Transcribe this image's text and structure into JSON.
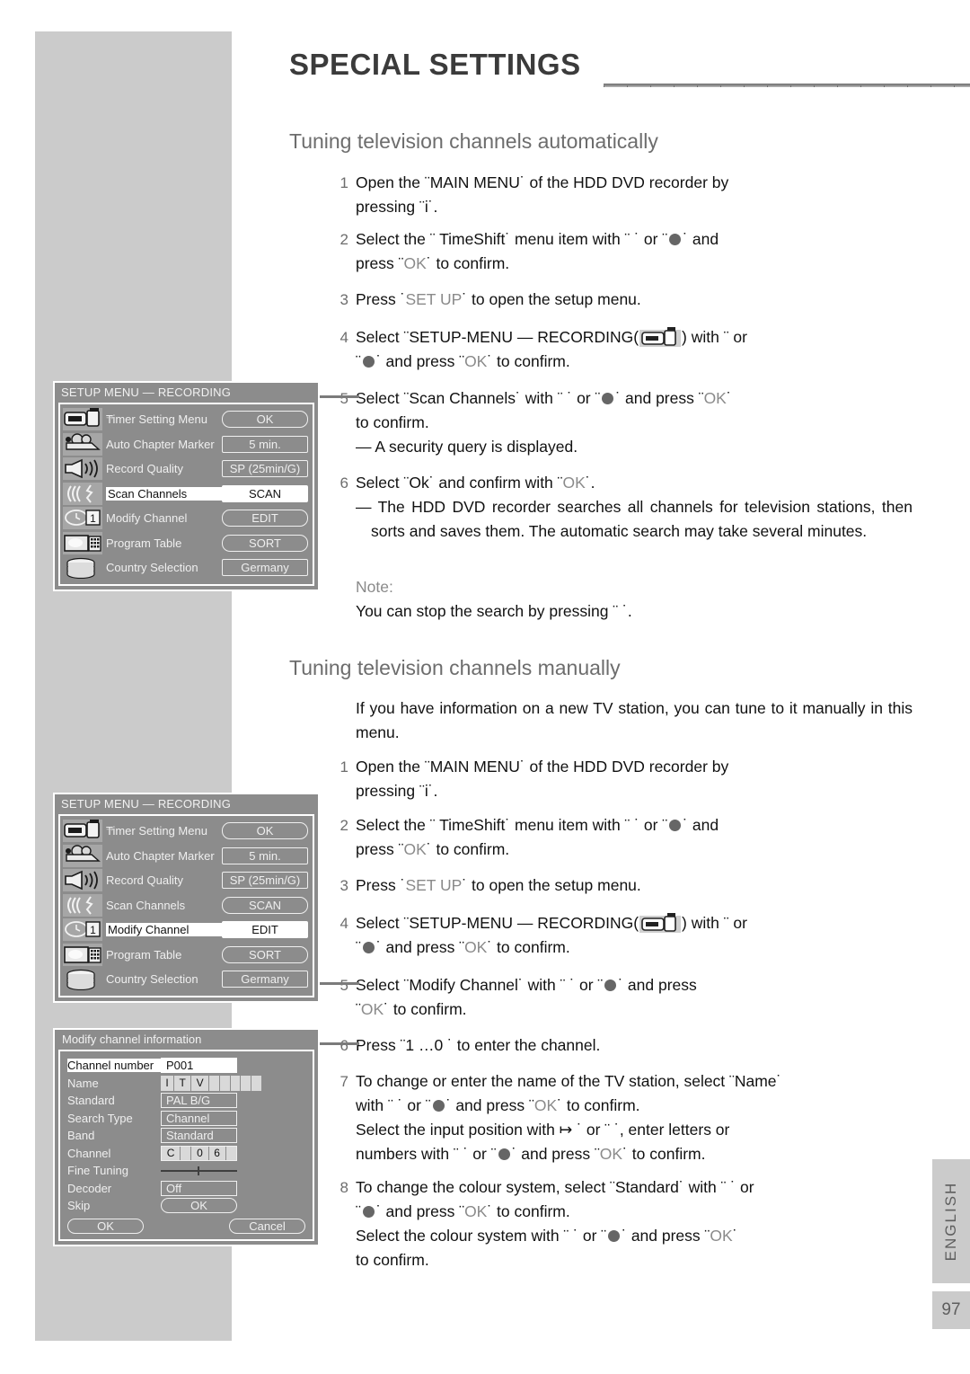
{
  "header": {
    "title": "SPECIAL SETTINGS"
  },
  "sections": {
    "auto": {
      "heading": "Tuning television channels automatically",
      "steps": [
        {
          "num": "1",
          "text_parts": [
            "Open the ¨MAIN MENU˙ of the HDD DVD recorder by pressing ¨i˙."
          ]
        },
        {
          "num": "2",
          "text_parts": [
            "Select the ¨      TimeShift˙ menu item with ¨   ˙ or ¨",
            "˙ and press ¨OK˙ to confirm."
          ]
        },
        {
          "num": "3",
          "text_parts": [
            "Press ˙SET UP˙ to open the setup menu."
          ]
        },
        {
          "num": "4",
          "text_parts": [
            "Select ¨SETUP-MENU — RECORDING(",
            ") with ¨ or ¨",
            "˙ and press ¨OK˙ to confirm."
          ]
        },
        {
          "num": "5",
          "text_parts": [
            "Select ¨Scan Channels˙ with ¨   ˙ or ¨",
            "˙ and press ¨OK˙ to confirm."
          ],
          "dash": "— A security query is displayed."
        },
        {
          "num": "6",
          "text_parts": [
            "Select ¨Ok˙ and confirm with ¨OK˙."
          ],
          "dash": "— The HDD DVD recorder searches all channels for television stations, then sorts and saves them. The automatic search may take several minutes."
        }
      ],
      "note_label": "Note:",
      "note_text": "You can stop the search by pressing ¨  ˙."
    },
    "manual": {
      "heading": "Tuning television channels manually",
      "intro": "If you have information on a new TV station, you can tune to it manually in this menu.",
      "steps": [
        {
          "num": "1",
          "text": "Open the ¨MAIN MENU˙ of the HDD DVD recorder by pressing ¨i˙."
        },
        {
          "num": "2",
          "text": "Select the ¨      TimeShift˙ menu item with ¨   ˙ or ¨"
        },
        {
          "num": "3",
          "text": "Press ˙SET UP˙ to open the setup menu."
        },
        {
          "num": "4",
          "text": "Select ¨SETUP-MENU — RECORDING("
        },
        {
          "num": "5",
          "text": "Select ¨Modify Channel˙ with ¨   ˙ or ¨"
        },
        {
          "num": "6",
          "text": "Press ¨1 …0 ˙ to enter the channel."
        },
        {
          "num": "7",
          "text": "To change or enter the name of the TV station, select ¨Name˙"
        },
        {
          "num": "8",
          "text": "To change the colour system, select ¨Standard˙ with ¨ ˙ or"
        }
      ]
    }
  },
  "fragments": {
    "ok": "OK",
    "setup": "SET UP",
    "and_press_ok_confirm": "˙ and press ¨OK˙ to confirm.",
    "press_ok_confirm": "press ¨OK˙ to confirm.",
    "s2_a": "Select the ¨      TimeShift˙ menu item with ¨   ˙ or ¨",
    "s2_b": "˙ and",
    "s2_c": "press ¨",
    "s2_d": "˙ to confirm.",
    "s3_a": "Press ˙",
    "s3_b": "˙ to open the setup menu.",
    "s4_a": "Select ¨SETUP-MENU — RECORDING(",
    "s4_b": ") with ¨ or",
    "s4_c": "¨",
    "s4_d": "˙ and press ¨",
    "s4_e": "˙ to confirm.",
    "s5auto_a": "Select ¨Scan Channels˙ with ¨   ˙ or ¨",
    "s5auto_b": "˙ and press ¨",
    "s5auto_c": "˙",
    "s5auto_d": "to confirm.",
    "s5auto_dash": "— A security query is displayed.",
    "s6auto_a": "Select ¨Ok˙ and confirm with ¨",
    "s6auto_b": "˙.",
    "s6auto_dash": "— The HDD DVD recorder searches all channels for television stations, then sorts and saves them. The automatic search may take several minutes.",
    "s1_a": "Open the ¨MAIN MENU˙ of the HDD DVD recorder by",
    "s1_b": "pressing ¨i˙.",
    "m5_a": "Select ¨Modify Channel˙ with ¨   ˙ or ¨",
    "m5_b": "˙ and press",
    "m5_c": "¨",
    "m5_d": "˙ to confirm.",
    "m6": "Press ¨1 …0 ˙ to enter the channel.",
    "m7_a": "To change or enter the name of the TV station, select ¨Name˙",
    "m7_b": "with ¨   ˙ or ¨",
    "m7_c": "˙ and press ¨",
    "m7_d": "˙ to confirm.",
    "m7_e": "Select the input position with ↦ ˙ or ¨     ˙, enter letters or",
    "m7_f": "numbers with ¨   ˙ or ¨",
    "m7_g": "˙ and press ¨",
    "m7_h": "˙ to confirm.",
    "m8_a": "To change the colour system, select ¨Standard˙ with ¨ ˙ or",
    "m8_b": "¨",
    "m8_c": "˙ and press ¨",
    "m8_d": "˙ to confirm.",
    "m8_e": "Select the colour system with ¨ ˙ or ¨",
    "m8_f": "˙ and press ¨",
    "m8_g": "˙",
    "m8_h": "to confirm."
  },
  "osd_menu": {
    "title": "SETUP MENU — RECORDING",
    "arrow": "→",
    "rows": [
      {
        "icon": "camcorder-icon",
        "label": "Timer Setting Menu",
        "value": "OK",
        "shape": "round"
      },
      {
        "icon": "projector-icon",
        "label": "Auto Chapter Marker",
        "value": "5 min.",
        "shape": "square"
      },
      {
        "icon": "speaker-icon",
        "label": "Record Quality",
        "value": "SP (25min/G)",
        "shape": "square"
      },
      {
        "icon": "signal-icon",
        "label": "Scan Channels",
        "value": "SCAN",
        "shape": "round"
      },
      {
        "icon": "clock-date-icon",
        "label": "Modify Channel",
        "value": "EDIT",
        "shape": "round"
      },
      {
        "icon": "tv-keypad-icon",
        "label": "Program Table",
        "value": "SORT",
        "shape": "round"
      },
      {
        "icon": "disc-stack-icon",
        "label": "Country Selection",
        "value": "Germany",
        "shape": "square"
      }
    ],
    "selected_auto": 3,
    "selected_manual": 4
  },
  "modify_dialog": {
    "title": "Modify channel information",
    "rows": [
      {
        "label": "Channel number",
        "value": "P001",
        "type": "text",
        "selected": true
      },
      {
        "label": "Name",
        "value": "",
        "type": "name"
      },
      {
        "label": "Standard",
        "value": "PAL B/G",
        "type": "box"
      },
      {
        "label": "Search Type",
        "value": "Channel",
        "type": "box"
      },
      {
        "label": "Band",
        "value": "Standard",
        "type": "box"
      },
      {
        "label": "Channel",
        "value": "",
        "type": "chan"
      },
      {
        "label": "Fine Tuning",
        "value": "",
        "type": "slider"
      },
      {
        "label": "Decoder",
        "value": "Off",
        "type": "box"
      },
      {
        "label": "Skip",
        "value": "OK",
        "type": "round"
      }
    ],
    "name_cells": [
      "I",
      "T",
      "V",
      "",
      "",
      "",
      "",
      ""
    ],
    "channel_cells": [
      "C",
      "",
      "0",
      "6",
      ""
    ],
    "ok_label": "OK",
    "cancel_label": "Cancel"
  },
  "footer": {
    "language": "ENGLISH",
    "page_number": "97"
  }
}
